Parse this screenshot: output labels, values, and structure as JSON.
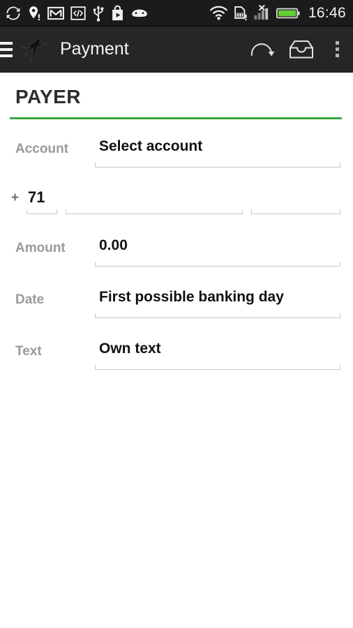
{
  "status_bar": {
    "time": "16:46",
    "left_icons": [
      {
        "name": "sync-icon",
        "label": "Sync"
      },
      {
        "name": "location-alert-icon",
        "label": "Location"
      },
      {
        "name": "gmail-icon",
        "label": "Gmail"
      },
      {
        "name": "developer-code-icon",
        "label": "USB debugging"
      },
      {
        "name": "usb-icon",
        "label": "USB connected"
      },
      {
        "name": "play-store-icon",
        "label": "Play Store"
      },
      {
        "name": "android-robot-icon",
        "label": "Android"
      }
    ],
    "right_icons": [
      {
        "name": "wifi-icon",
        "label": "Wi-Fi"
      },
      {
        "name": "sim-card-alert-icon",
        "label": "No SIM card"
      },
      {
        "name": "cellular-signal-off-icon",
        "label": "No signal"
      },
      {
        "name": "battery-full-icon",
        "label": "Battery full"
      }
    ],
    "colors": {
      "background": "#1b1b1b",
      "icon": "#f2f2f2",
      "battery_green": "#66cc33"
    }
  },
  "action_bar": {
    "menu_label": "Menu",
    "logo_label": "Swift bird logo",
    "title": "Payment",
    "actions": [
      {
        "name": "redo-action",
        "label": "Redo"
      },
      {
        "name": "inbox-action",
        "label": "Inbox"
      }
    ],
    "overflow_label": "More options",
    "colors": {
      "background": "#262626",
      "title": "#f4f4f4"
    }
  },
  "form": {
    "section_title": "PAYER",
    "accent_color": "#3aa63f",
    "account": {
      "label": "Account",
      "value": "Select account",
      "placeholder": "Select account"
    },
    "phone": {
      "plus": "+",
      "country_code": "71",
      "country_code_placeholder": "",
      "number": "",
      "number_placeholder": "",
      "suffix": "",
      "suffix_placeholder": ""
    },
    "amount": {
      "label": "Amount",
      "value": "0.00",
      "placeholder": "0.00"
    },
    "date": {
      "label": "Date",
      "value": "First possible banking day",
      "placeholder": "First possible banking day"
    },
    "text": {
      "label": "Text",
      "value": "Own text",
      "placeholder": "Own text"
    }
  }
}
